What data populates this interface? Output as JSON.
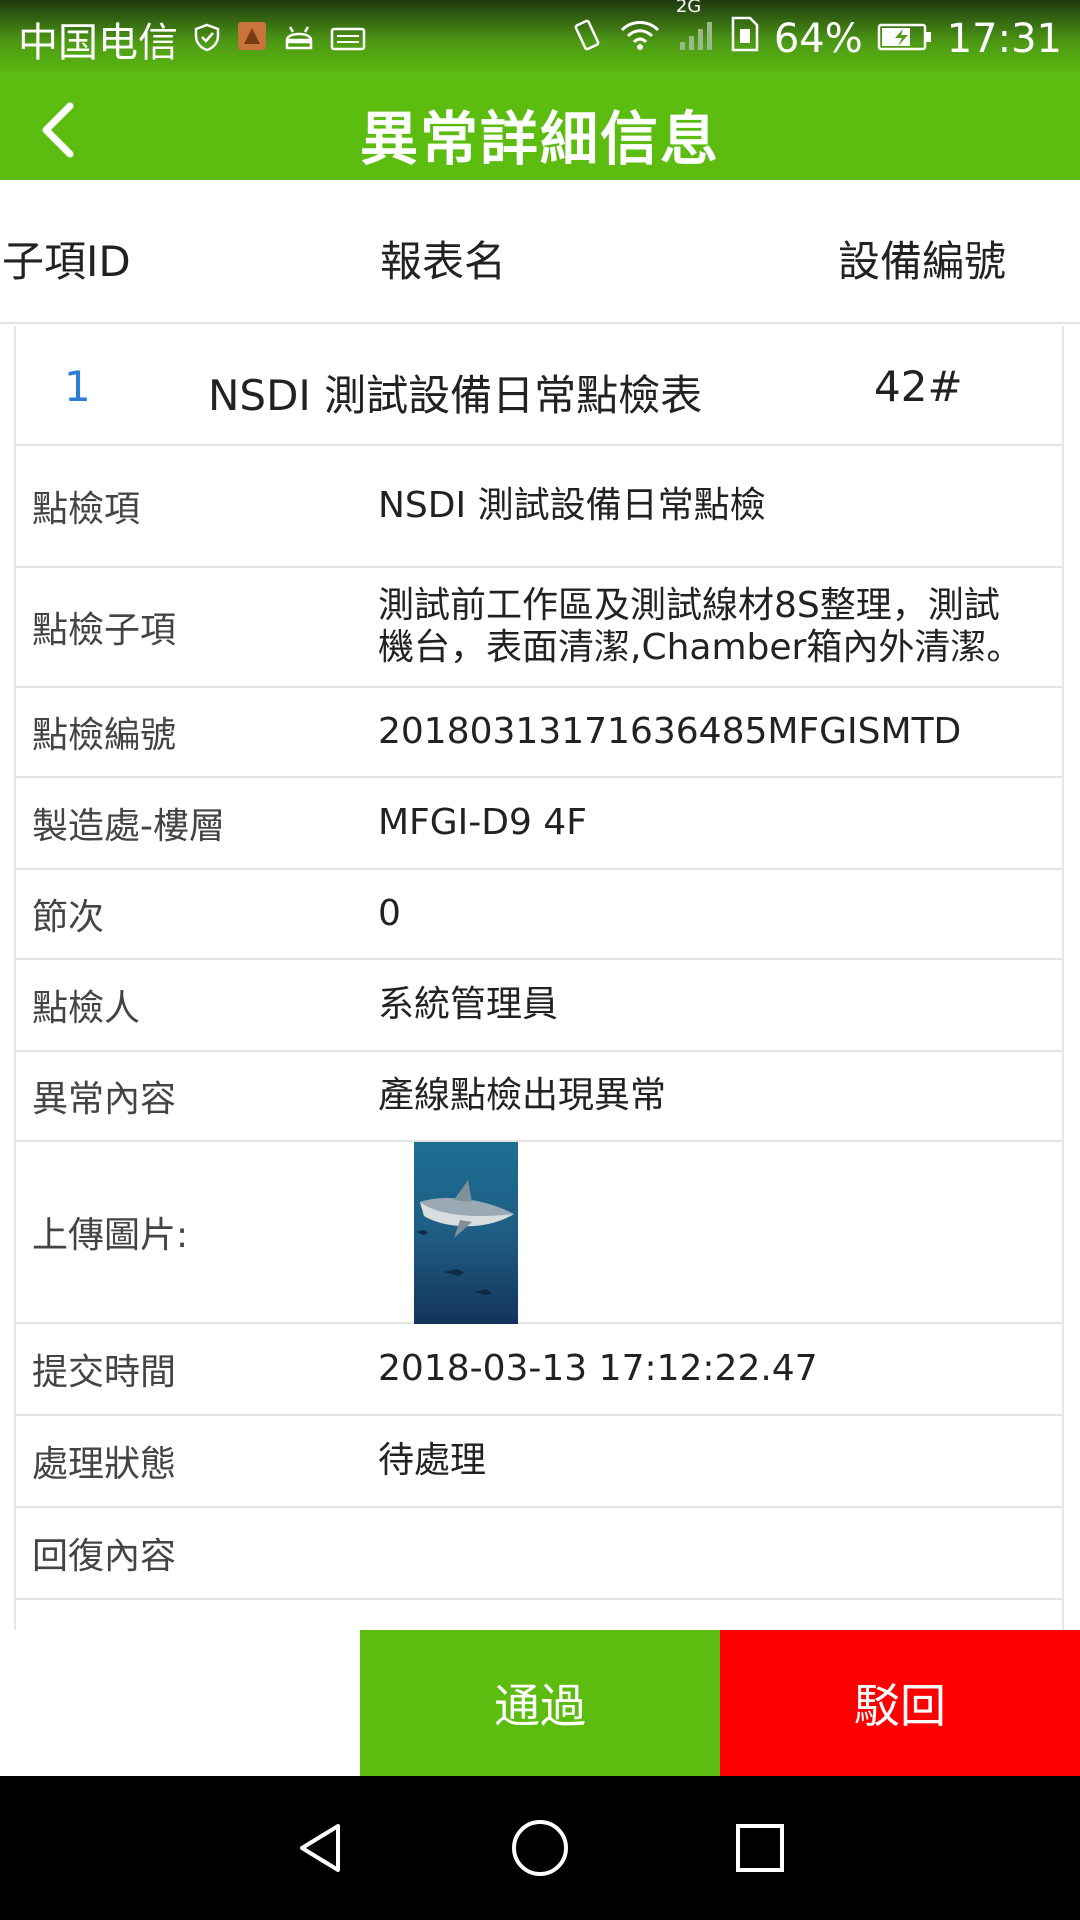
{
  "status_bar": {
    "carrier": "中国电信",
    "network": "2G",
    "battery_percent": "64%",
    "time": "17:31",
    "icons": [
      "shield-check-icon",
      "app-notification-icon",
      "android-icon",
      "keyboard-icon",
      "vibrate-icon",
      "wifi-icon",
      "signal-icon",
      "sim-icon",
      "battery-charging-icon"
    ]
  },
  "header": {
    "title": "異常詳細信息",
    "back_icon": "chevron-left-icon"
  },
  "columns": {
    "id": "子項ID",
    "report_name": "報表名",
    "device_no": "設備編號"
  },
  "summary": {
    "id": "1",
    "report_name": "NSDI 測試設備日常點檢表",
    "device_no": "42#"
  },
  "details": [
    {
      "label": "點檢項",
      "value": "NSDI 測試設備日常點檢"
    },
    {
      "label": "點檢子項",
      "value": "測試前工作區及測試線材8S整理，測試機台，表面清潔,Chamber箱內外清潔。"
    },
    {
      "label": "點檢編號",
      "value": "20180313171636485MFGISMTD"
    },
    {
      "label": "製造處-樓層",
      "value": "MFGI-D9 4F"
    },
    {
      "label": "節次",
      "value": "0"
    },
    {
      "label": "點檢人",
      "value": "系統管理員"
    },
    {
      "label": "異常內容",
      "value": "產線點檢出現異常"
    },
    {
      "label": "上傳圖片:",
      "value": ""
    },
    {
      "label": "提交時間",
      "value": "2018-03-13 17:12:22.47"
    },
    {
      "label": "處理狀態",
      "value": "待處理"
    },
    {
      "label": "回復內容",
      "value": ""
    }
  ],
  "actions": {
    "pass_label": "通過",
    "reject_label": "駁回"
  },
  "colors": {
    "accent_green": "#5cbd10",
    "reject_red": "#ff0000",
    "id_blue": "#2a7fd4"
  }
}
